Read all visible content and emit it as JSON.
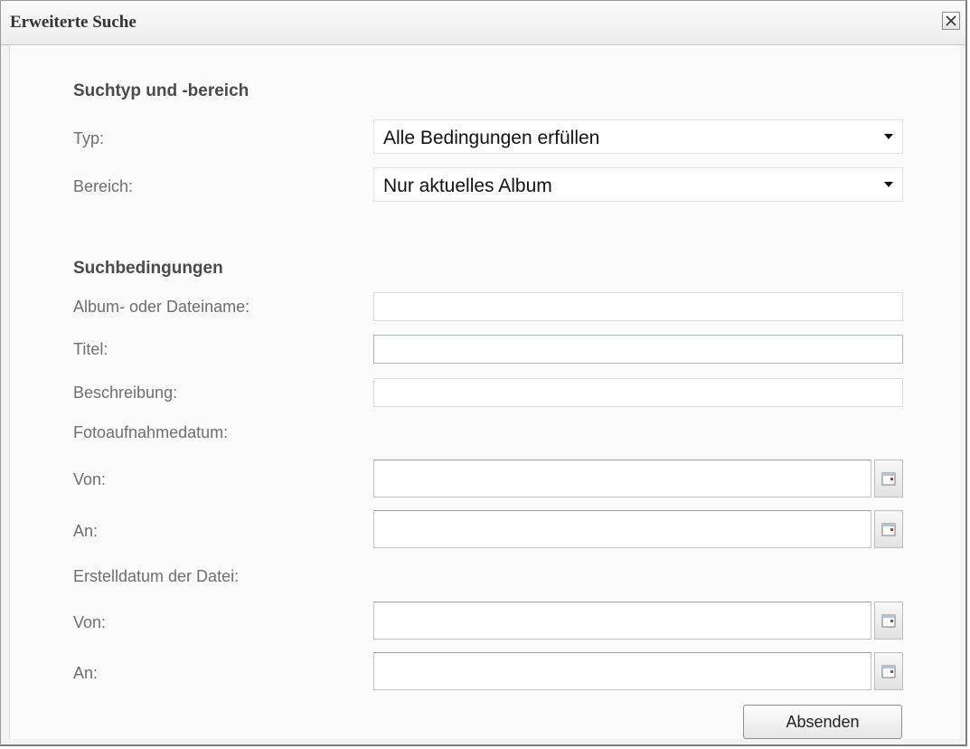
{
  "dialog": {
    "title": "Erweiterte Suche"
  },
  "section_type": {
    "heading": "Suchtyp und -bereich",
    "type_label": "Typ:",
    "type_value": "Alle Bedingungen erfüllen",
    "scope_label": "Bereich:",
    "scope_value": "Nur aktuelles Album"
  },
  "section_conditions": {
    "heading": "Suchbedingungen",
    "album_label": "Album- oder Dateiname:",
    "album_value": "",
    "title_label": "Titel:",
    "title_value": "",
    "description_label": "Beschreibung:",
    "description_value": "",
    "photo_date_label": "Fotoaufnahmedatum:",
    "photo_from_label": "Von:",
    "photo_from_value": "",
    "photo_to_label": "An:",
    "photo_to_value": "",
    "file_date_label": "Erstelldatum der Datei:",
    "file_from_label": "Von:",
    "file_from_value": "",
    "file_to_label": "An:",
    "file_to_value": ""
  },
  "actions": {
    "submit_label": "Absenden"
  },
  "icons": {
    "close": "close-icon",
    "dropdown": "chevron-down-icon",
    "calendar": "calendar-icon"
  }
}
